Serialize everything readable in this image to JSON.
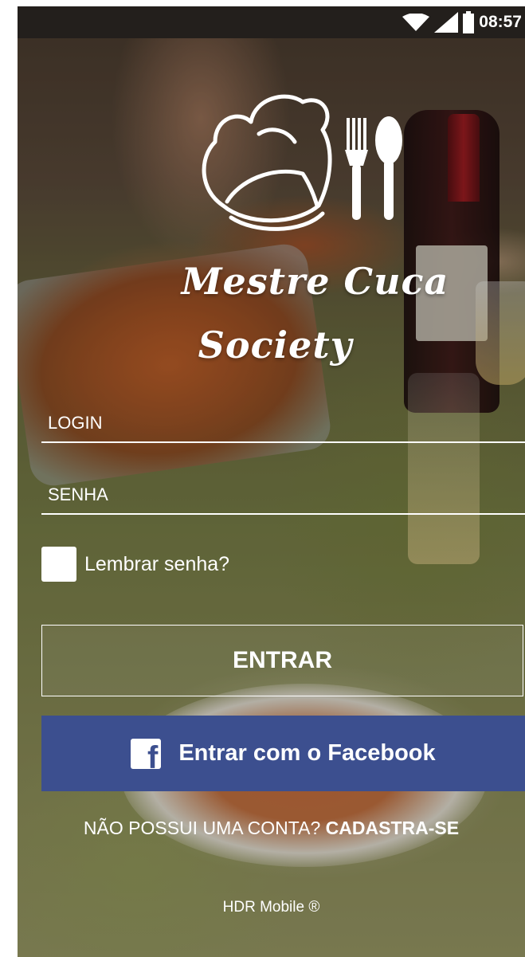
{
  "status_bar": {
    "time": "08:57",
    "icons": [
      "wifi-icon",
      "signal-icon",
      "battery-icon"
    ]
  },
  "brand": {
    "line1": "Mestre Cuca",
    "line2": "Society",
    "logo_icons": [
      "chef-hat-icon",
      "fork-icon",
      "spoon-icon"
    ]
  },
  "form": {
    "login_placeholder": "LOGIN",
    "password_placeholder": "SENHA",
    "remember_label": "Lembrar senha?"
  },
  "buttons": {
    "entrar": "ENTRAR",
    "facebook": "Entrar com o Facebook"
  },
  "signup": {
    "prompt": "NÃO POSSUI UMA CONTA?",
    "link": "CADASTRA-SE"
  },
  "footer": {
    "credit": "HDR Mobile ®"
  },
  "colors": {
    "facebook_blue": "#3c4f8f",
    "status_bar": "#231f1c",
    "text": "#ffffff"
  }
}
